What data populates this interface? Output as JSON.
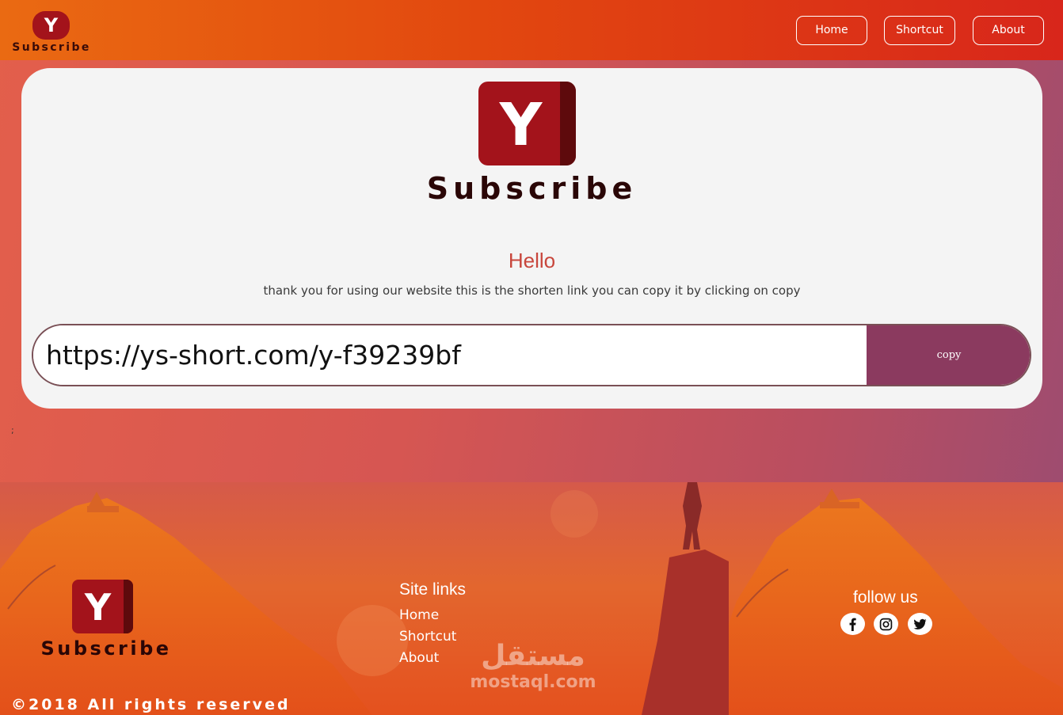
{
  "header": {
    "logo_letter": "Y",
    "brand": "Subscribe",
    "nav": [
      {
        "label": "Home"
      },
      {
        "label": "Shortcut"
      },
      {
        "label": "About"
      }
    ]
  },
  "main": {
    "logo_letter": "Y",
    "brand": "Subscribe",
    "greeting": "Hello",
    "message": "thank you for using our website this is the shorten link you can copy it by clicking on copy",
    "short_link": "https://ys-short.com/y-f39239bf",
    "copy_label": "copy",
    "stray_text": ";"
  },
  "footer": {
    "logo_letter": "Y",
    "brand": "Subscribe",
    "copyright": "©2018 All rights reserved",
    "site_links_title": "Site links",
    "site_links": [
      {
        "label": "Home"
      },
      {
        "label": "Shortcut"
      },
      {
        "label": "About"
      }
    ],
    "follow_title": "follow us",
    "social": [
      {
        "icon": "facebook-icon"
      },
      {
        "icon": "instagram-icon"
      },
      {
        "icon": "twitter-icon"
      }
    ],
    "watermark_ar": "مستقل",
    "watermark_en": "mostaql.com"
  },
  "colors": {
    "header_orange": "#ea6a12",
    "header_red": "#d8261b",
    "logo_red": "#a3131b",
    "copy_button": "#8b3a5f",
    "hello_text": "#c8463c"
  }
}
